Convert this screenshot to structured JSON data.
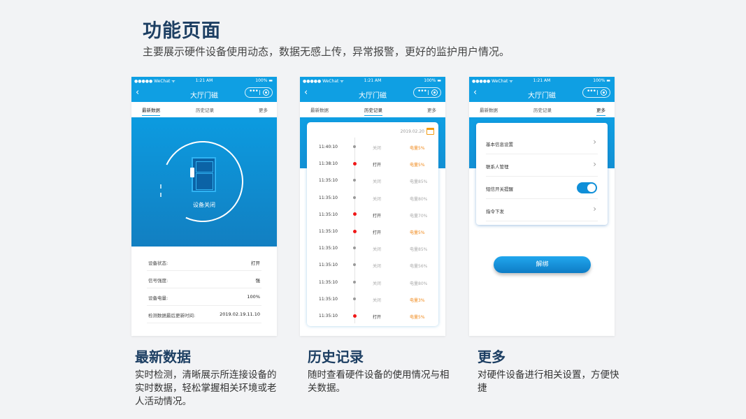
{
  "header": {
    "title": "功能页面",
    "subtitle": "主要展示硬件设备使用动态，数据无感上传，异常报警，更好的监护用户情况。"
  },
  "phone_common": {
    "carrier": "●●●●● WeChat ᯤ",
    "time": "1:21 AM",
    "battery": "100% ▬",
    "nav_title": "大厅门磁",
    "back": "‹",
    "capsule_dots": "•••",
    "tabs": [
      "最新数据",
      "历史记录",
      "更多"
    ]
  },
  "latest": {
    "device_status_caption": "设备关闭",
    "rows": [
      {
        "label": "设备状态:",
        "value": "打开"
      },
      {
        "label": "信号强度:",
        "value": "强"
      },
      {
        "label": "设备电量:",
        "value": "100%"
      },
      {
        "label": "检测数据最后更新时间:",
        "value": "2019.02.19.11.10"
      }
    ]
  },
  "history": {
    "date": "2019.02.20",
    "entries": [
      {
        "time": "11:40:10",
        "action": "关闭",
        "battery": "电量5%",
        "open": false,
        "warn": true
      },
      {
        "time": "11:38:10",
        "action": "打开",
        "battery": "电量5%",
        "open": true,
        "warn": true
      },
      {
        "time": "11:35:10",
        "action": "关闭",
        "battery": "电量85%",
        "open": false,
        "warn": false
      },
      {
        "time": "11:35:10",
        "action": "关闭",
        "battery": "电量80%",
        "open": false,
        "warn": false
      },
      {
        "time": "11:35:10",
        "action": "打开",
        "battery": "电量70%",
        "open": true,
        "warn": false
      },
      {
        "time": "11:35:10",
        "action": "打开",
        "battery": "电量5%",
        "open": true,
        "warn": true
      },
      {
        "time": "11:35:10",
        "action": "关闭",
        "battery": "电量85%",
        "open": false,
        "warn": false
      },
      {
        "time": "11:35:10",
        "action": "关闭",
        "battery": "电量56%",
        "open": false,
        "warn": false
      },
      {
        "time": "11:35:10",
        "action": "关闭",
        "battery": "电量80%",
        "open": false,
        "warn": false
      },
      {
        "time": "11:35:10",
        "action": "关闭",
        "battery": "电量3%",
        "open": false,
        "warn": true
      },
      {
        "time": "11:35:10",
        "action": "打开",
        "battery": "电量5%",
        "open": true,
        "warn": true
      }
    ]
  },
  "more": {
    "settings": [
      {
        "label": "基本信息设置",
        "type": "link"
      },
      {
        "label": "联系人管理",
        "type": "link"
      },
      {
        "label": "短信开关提醒",
        "type": "toggle",
        "on": true
      },
      {
        "label": "指令下发",
        "type": "link"
      }
    ],
    "unbind_label": "解绑"
  },
  "captions": [
    {
      "title": "最新数据",
      "desc": "实时检测，清晰展示所连接设备的实时数据，轻松掌握相关环境或老人活动情况。"
    },
    {
      "title": "历史记录",
      "desc": "随时查看硬件设备的使用情况与相关数据。"
    },
    {
      "title": "更多",
      "desc": "对硬件设备进行相关设置，方便快捷"
    }
  ],
  "colors": {
    "primary": "#0f9fe3",
    "dark_blue": "#1d3f63",
    "warn": "#f08a1c",
    "open_dot": "#f01818"
  }
}
